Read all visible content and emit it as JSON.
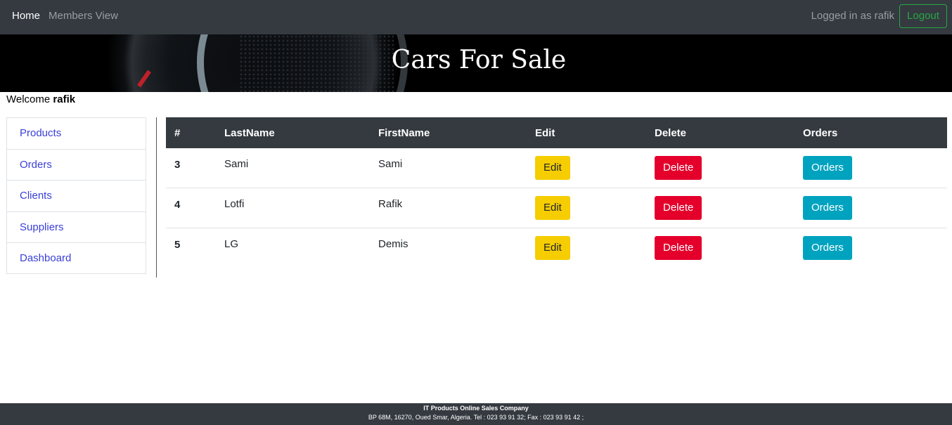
{
  "nav": {
    "home": "Home",
    "members_view": "Members View",
    "logged_in_text": "Logged in as rafik",
    "logout": "Logout"
  },
  "banner": {
    "title": "Cars For Sale"
  },
  "welcome": {
    "prefix": "Welcome",
    "username": "rafik"
  },
  "sidebar": {
    "items": [
      {
        "label": "Products"
      },
      {
        "label": "Orders"
      },
      {
        "label": "Clients"
      },
      {
        "label": "Suppliers"
      },
      {
        "label": "Dashboard"
      }
    ]
  },
  "table": {
    "headers": [
      "#",
      "LastName",
      "FirstName",
      "Edit",
      "Delete",
      "Orders"
    ],
    "rows": [
      {
        "id": "3",
        "last": "Sami",
        "first": "Sami",
        "edit": "Edit",
        "delete": "Delete",
        "orders": "Orders"
      },
      {
        "id": "4",
        "last": "Lotfi",
        "first": "Rafik",
        "edit": "Edit",
        "delete": "Delete",
        "orders": "Orders"
      },
      {
        "id": "5",
        "last": "LG",
        "first": "Demis",
        "edit": "Edit",
        "delete": "Delete",
        "orders": "Orders"
      }
    ]
  },
  "footer": {
    "company": "IT Products Online Sales Company",
    "address": "BP 68M, 16270, Oued Smar, Algeria. Tel : 023 93 91 32; Fax : 023 93 91 42 ;"
  },
  "colors": {
    "navbar_bg": "#343a40",
    "logout_green": "#28a745",
    "edit_yellow": "#f5cd00",
    "delete_red": "#e4002b",
    "orders_teal": "#00a3bf",
    "link_blue": "#3a3fd8"
  }
}
